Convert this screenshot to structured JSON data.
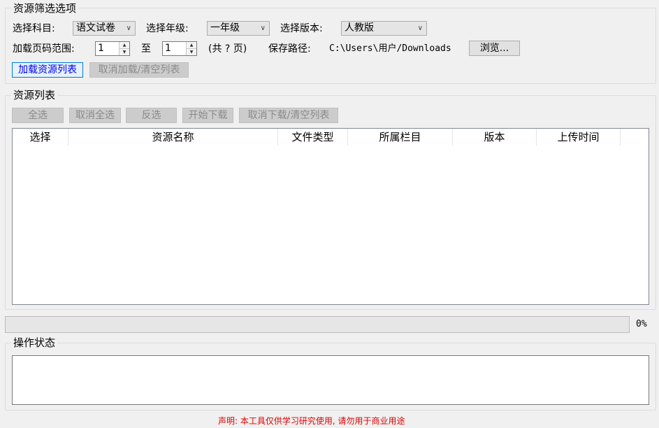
{
  "filter_group": {
    "title": "资源筛选选项",
    "subject_label": "选择科目:",
    "subject_value": "语文试卷",
    "grade_label": "选择年级:",
    "grade_value": "一年级",
    "edition_label": "选择版本:",
    "edition_value": "人教版",
    "page_range_label": "加载页码范围:",
    "page_from": "1",
    "to_label": "至",
    "page_to": "1",
    "total_pages": "(共 ? 页)",
    "save_path_label": "保存路径:",
    "save_path_value": "C:\\Users\\用户/Downloads",
    "browse_label": "浏览...",
    "load_list_label": "加载资源列表",
    "cancel_load_label": "取消加载/清空列表"
  },
  "list_group": {
    "title": "资源列表",
    "select_all_label": "全选",
    "deselect_all_label": "取消全选",
    "invert_label": "反选",
    "start_download_label": "开始下载",
    "cancel_download_label": "取消下载/清空列表",
    "columns": [
      "选择",
      "资源名称",
      "文件类型",
      "所属栏目",
      "版本",
      "上传时间"
    ]
  },
  "progress": {
    "value": 0,
    "label": "0%"
  },
  "status_group": {
    "title": "操作状态"
  },
  "disclaimer": "声明: 本工具仅供学习研究使用, 请勿用于商业用途"
}
